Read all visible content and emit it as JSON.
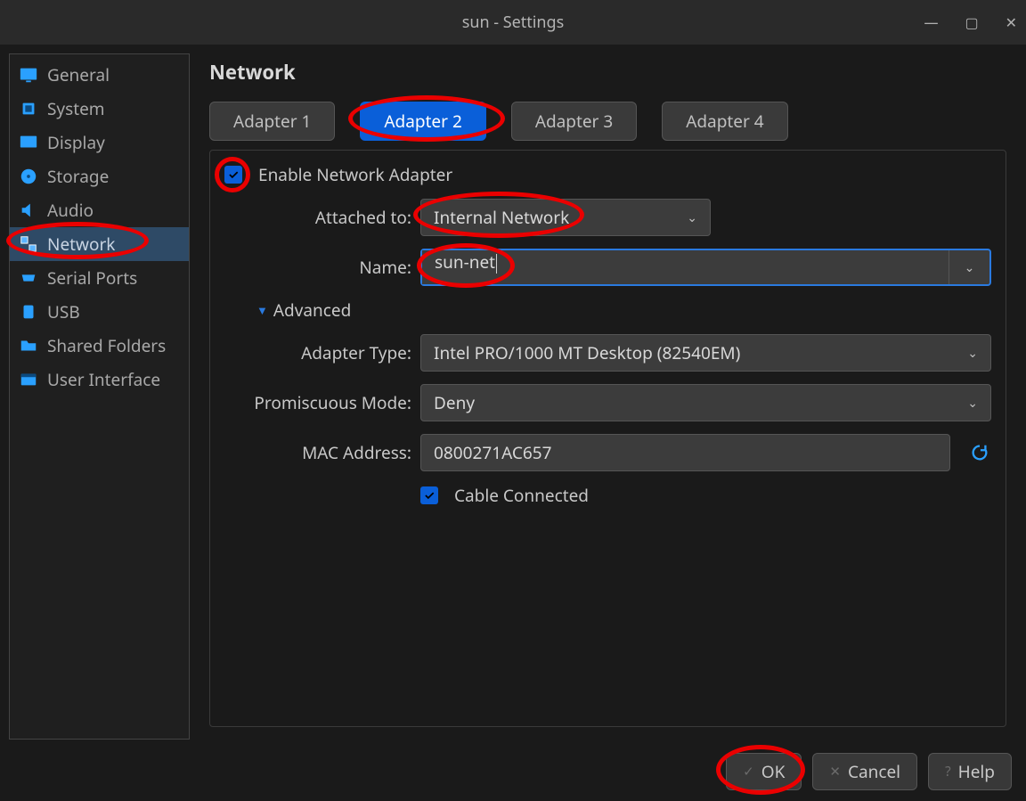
{
  "window": {
    "title": "sun - Settings"
  },
  "sidebar": {
    "items": [
      {
        "label": "General"
      },
      {
        "label": "System"
      },
      {
        "label": "Display"
      },
      {
        "label": "Storage"
      },
      {
        "label": "Audio"
      },
      {
        "label": "Network"
      },
      {
        "label": "Serial Ports"
      },
      {
        "label": "USB"
      },
      {
        "label": "Shared Folders"
      },
      {
        "label": "User Interface"
      }
    ]
  },
  "page": {
    "title": "Network"
  },
  "tabs": [
    {
      "label": "Adapter 1"
    },
    {
      "label": "Adapter 2"
    },
    {
      "label": "Adapter 3"
    },
    {
      "label": "Adapter 4"
    }
  ],
  "form": {
    "enable_label": "Enable Network Adapter",
    "attached_to_label": "Attached to:",
    "attached_to_value": "Internal Network",
    "name_label": "Name:",
    "name_value": "sun-net",
    "advanced_label": "Advanced",
    "adapter_type_label": "Adapter Type:",
    "adapter_type_value": "Intel PRO/1000 MT Desktop (82540EM)",
    "promiscuous_label": "Promiscuous Mode:",
    "promiscuous_value": "Deny",
    "mac_label": "MAC Address:",
    "mac_value": "0800271AC657",
    "cable_label": "Cable Connected"
  },
  "footer": {
    "ok": "OK",
    "cancel": "Cancel",
    "help": "Help"
  }
}
